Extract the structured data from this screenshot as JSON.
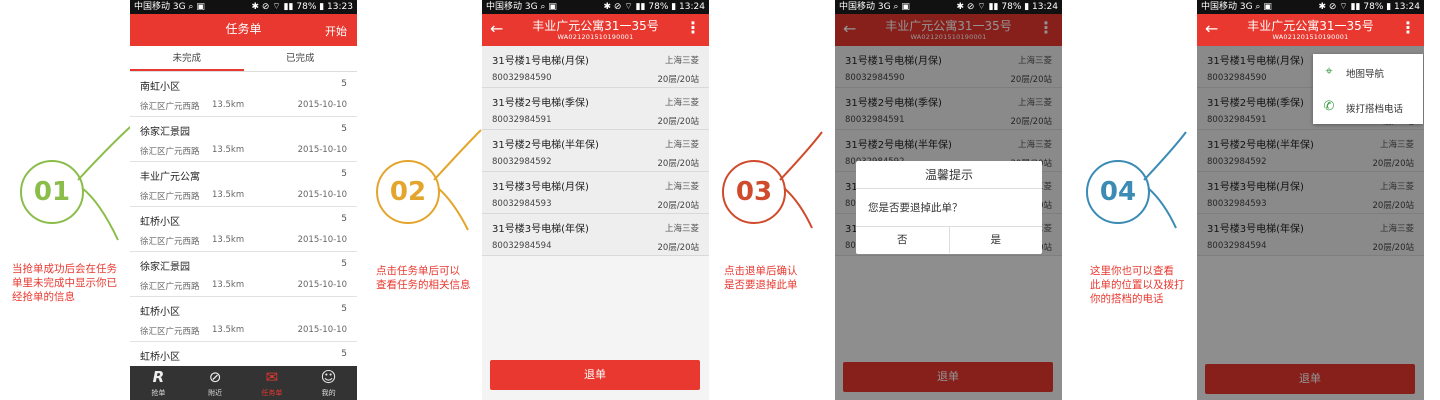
{
  "steps": [
    {
      "number": "01",
      "color": "#8bbd4a",
      "note": [
        "当抢单成功后会在任务",
        "单里未完成中显示你已",
        "经抢单的信息"
      ]
    },
    {
      "number": "02",
      "color": "#e3a52b",
      "note": [
        "点击任务单后可以",
        "查看任务的相关信息"
      ]
    },
    {
      "number": "03",
      "color": "#cf4b2c",
      "note": [
        "点击退单后确认",
        "是否要退掉此单"
      ]
    },
    {
      "number": "04",
      "color": "#3b8bb5",
      "note": [
        "这里你也可以查看",
        "此单的位置以及拨打",
        "你的搭档的电话"
      ]
    }
  ],
  "status_bars": [
    {
      "left": "中国移动 3G ⌕ ▣",
      "right": "✱ ⊘ ⌔ ▮▮ 78% ▮ 13:23"
    },
    {
      "left": "中国移动 3G ⌕ ▣",
      "right": "✱ ⊘ ⌔ ▮▮ 78% ▮ 13:24"
    },
    {
      "left": "中国移动 3G ⌕ ▣",
      "right": "✱ ⊘ ⌔ ▮▮ 78% ▮ 13:24"
    },
    {
      "left": "中国移动 3G ⌕ ▣",
      "right": "✱ ⊘ ⌔ ▮▮ 78% ▮ 13:24"
    }
  ],
  "screen1": {
    "title": "任务单",
    "start_label": "开始",
    "tabs": [
      "未完成",
      "已完成"
    ],
    "tasks": [
      {
        "name": "南虹小区",
        "count": "5",
        "address": "徐汇区广元西路",
        "distance": "13.5km",
        "date": "2015-10-10"
      },
      {
        "name": "徐家汇景园",
        "count": "5",
        "address": "徐汇区广元西路",
        "distance": "13.5km",
        "date": "2015-10-10"
      },
      {
        "name": "丰业广元公寓",
        "count": "5",
        "address": "徐汇区广元西路",
        "distance": "13.5km",
        "date": "2015-10-10"
      },
      {
        "name": "虹桥小区",
        "count": "5",
        "address": "徐汇区广元西路",
        "distance": "13.5km",
        "date": "2015-10-10"
      },
      {
        "name": "徐家汇景园",
        "count": "5",
        "address": "徐汇区广元西路",
        "distance": "13.5km",
        "date": "2015-10-10"
      },
      {
        "name": "虹桥小区",
        "count": "5",
        "address": "徐汇区广元西路",
        "distance": "13.5km",
        "date": "2015-10-10"
      },
      {
        "name": "虹桥小区",
        "count": "5",
        "address": "",
        "distance": "",
        "date": ""
      }
    ],
    "nav": [
      {
        "icon": "R",
        "label": "抢单",
        "icon_name": "grab-order-icon"
      },
      {
        "icon": "⊘",
        "label": "附近",
        "icon_name": "compass-icon"
      },
      {
        "icon": "✉",
        "label": "任务单",
        "icon_name": "task-list-icon"
      },
      {
        "icon": "☺",
        "label": "我的",
        "icon_name": "profile-icon"
      }
    ]
  },
  "detail": {
    "title": "丰业广元公寓31一35号",
    "order_no": "WA021201510190001",
    "back_icon": "←",
    "more_icon": "⋮",
    "elevators": [
      {
        "name": "31号楼1号电梯(月保)",
        "company": "上海三菱",
        "code": "80032984590",
        "floors": "20层/20站"
      },
      {
        "name": "31号楼2号电梯(季保)",
        "company": "上海三菱",
        "code": "80032984591",
        "floors": "20层/20站"
      },
      {
        "name": "31号楼2号电梯(半年保)",
        "company": "上海三菱",
        "code": "80032984592",
        "floors": "20层/20站"
      },
      {
        "name": "31号楼3号电梯(月保)",
        "company": "上海三菱",
        "code": "80032984593",
        "floors": "20层/20站"
      },
      {
        "name": "31号楼3号电梯(年保)",
        "company": "上海三菱",
        "code": "80032984594",
        "floors": "20层/20站"
      }
    ],
    "return_button": "退单"
  },
  "dialog": {
    "title": "温馨提示",
    "message": "您是否要退掉此单？",
    "no": "否",
    "yes": "是"
  },
  "popup_menu": [
    {
      "icon": "⌖",
      "label": "地图导航",
      "icon_name": "map-navigation-icon"
    },
    {
      "icon": "✆",
      "label": "拨打搭档电话",
      "icon_name": "phone-icon"
    }
  ]
}
